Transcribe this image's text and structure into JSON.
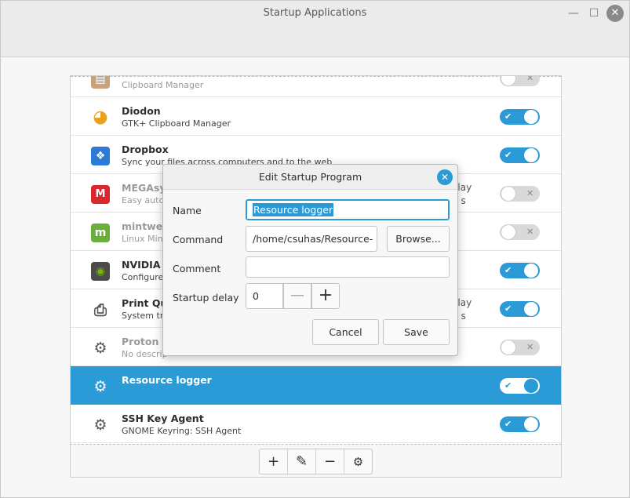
{
  "window": {
    "title": "Startup Applications",
    "min_glyph": "—",
    "max_glyph": "☐",
    "close_glyph": "✕"
  },
  "apps": [
    {
      "name": "",
      "desc": "Clipboard Manager",
      "enabled": false,
      "icon": "clipboard-icon",
      "delay": ""
    },
    {
      "name": "Diodon",
      "desc": "GTK+ Clipboard Manager",
      "enabled": true,
      "icon": "diodon-icon",
      "delay": ""
    },
    {
      "name": "Dropbox",
      "desc": "Sync your files across computers and to the web",
      "enabled": true,
      "icon": "dropbox-icon",
      "delay": ""
    },
    {
      "name": "MEGAsy",
      "desc": "Easy autor",
      "enabled": false,
      "icon": "mega-icon",
      "delay": "elay",
      "delay2": "0 s"
    },
    {
      "name": "mintwelc",
      "desc": "Linux Mint",
      "enabled": false,
      "icon": "mint-icon",
      "delay": ""
    },
    {
      "name": "NVIDIA",
      "desc": "Configure",
      "enabled": true,
      "icon": "nvidia-icon",
      "delay": ""
    },
    {
      "name": "Print Qu",
      "desc": "System tra",
      "enabled": true,
      "icon": "printer-icon",
      "delay": "elay",
      "delay2": "0 s"
    },
    {
      "name": "Proton M",
      "desc": "No descrip",
      "enabled": false,
      "icon": "gear-icon",
      "delay": ""
    },
    {
      "name": "Resource logger",
      "desc": "",
      "enabled": true,
      "icon": "gear-icon",
      "delay": "",
      "selected": true
    },
    {
      "name": "SSH Key Agent",
      "desc": "GNOME Keyring: SSH Agent",
      "enabled": true,
      "icon": "gear-icon",
      "delay": ""
    }
  ],
  "toolbar": {
    "add": "+",
    "edit": "✎",
    "remove": "−",
    "run": "⚙"
  },
  "dialog": {
    "title": "Edit Startup Program",
    "close_glyph": "✕",
    "name_label": "Name",
    "name_value": "Resource logger",
    "command_label": "Command",
    "command_value": "/home/csuhas/Resource-",
    "browse_label": "Browse...",
    "comment_label": "Comment",
    "comment_value": "",
    "delay_label": "Startup delay",
    "delay_value": "0",
    "minus": "—",
    "plus": "+",
    "cancel_label": "Cancel",
    "save_label": "Save"
  },
  "toggle_marks": {
    "on": "✔",
    "off": "✕"
  },
  "colors": {
    "accent": "#2b9bd7"
  }
}
